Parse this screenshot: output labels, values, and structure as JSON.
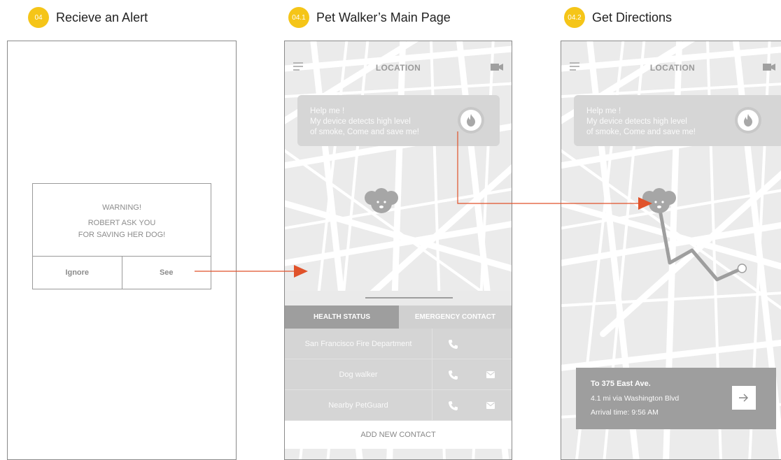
{
  "screen1": {
    "badge": "04",
    "heading": "Recieve an Alert",
    "dialog": {
      "title": "WARNING!",
      "message_line1": "ROBERT ASK YOU",
      "message_line2": "FOR SAVING HER DOG!",
      "ignore_label": "Ignore",
      "see_label": "See"
    }
  },
  "screen2": {
    "badge": "04.1",
    "heading": "Pet Walker’s Main Page",
    "topbar_title": "LOCATION",
    "alert": {
      "line1": "Help me !",
      "line2": "My device detects high level",
      "line3": "of smoke, Come and save me!"
    },
    "tabs": {
      "health": "HEALTH STATUS",
      "emergency": "EMERGENCY CONTACT"
    },
    "contacts": [
      {
        "name": "San Francisco Fire Department",
        "has_mail": false
      },
      {
        "name": "Dog walker",
        "has_mail": true
      },
      {
        "name": "Nearby PetGuard",
        "has_mail": true
      }
    ],
    "add_contact": "ADD NEW CONTACT"
  },
  "screen3": {
    "badge": "04.2",
    "heading": "Get Directions",
    "topbar_title": "LOCATION",
    "alert": {
      "line1": "Help me !",
      "line2": "My device detects high level",
      "line3": "of smoke, Come and save me!"
    },
    "directions": {
      "destination": "To 375 East Ave.",
      "route": "4.1 mi via Washington Blvd",
      "arrival": "Arrival time: 9:56 AM"
    }
  },
  "colors": {
    "badge": "#f5c518",
    "flow_arrow": "#e0522a",
    "route": "#9e9e9e"
  },
  "icons": [
    "menu-icon",
    "camera-icon",
    "fire-icon",
    "dog-icon",
    "phone-icon",
    "mail-icon",
    "arrow-right-icon"
  ]
}
